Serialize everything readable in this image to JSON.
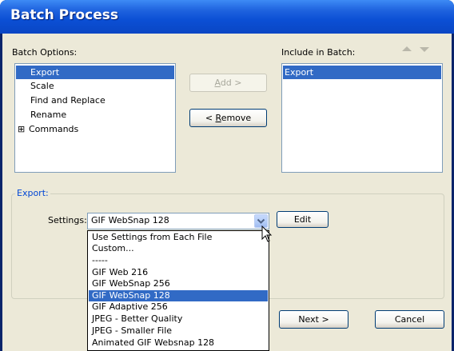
{
  "window": {
    "title": "Batch Process"
  },
  "batch_options": {
    "label": "Batch Options:",
    "items": [
      {
        "label": "Export",
        "selected": true,
        "expandable": false
      },
      {
        "label": "Scale",
        "selected": false,
        "expandable": false
      },
      {
        "label": "Find and Replace",
        "selected": false,
        "expandable": false
      },
      {
        "label": "Rename",
        "selected": false,
        "expandable": false
      },
      {
        "label": "Commands",
        "selected": false,
        "expandable": true,
        "expander": "⊞"
      }
    ]
  },
  "buttons": {
    "add": {
      "prefix": "",
      "underline": "A",
      "rest": "dd >"
    },
    "remove": {
      "prefix": "< ",
      "underline": "R",
      "rest": "emove"
    },
    "edit_label": "Edit",
    "next_label": "Next >",
    "cancel_label": "Cancel"
  },
  "include_in_batch": {
    "label": "Include in Batch:",
    "items": [
      {
        "label": "Export",
        "selected": true
      }
    ]
  },
  "export_group": {
    "title": "Export:",
    "settings_label": "Settings:",
    "settings_value": "GIF WebSnap 128",
    "options": [
      "Use Settings from Each File",
      "Custom...",
      "-----",
      "GIF Web 216",
      "GIF WebSnap 256",
      "GIF WebSnap 128",
      "GIF Adaptive 256",
      "JPEG - Better Quality",
      "JPEG - Smaller File",
      "Animated GIF Websnap 128"
    ],
    "highlighted_option": "GIF WebSnap 128"
  },
  "icons": {
    "move_up": "triangle-up",
    "move_down": "triangle-down",
    "combo_arrow": "chevron-down",
    "cursor": "mouse-pointer"
  },
  "colors": {
    "title_bar": "#0b4fd4",
    "selection": "#316ac5",
    "group_title": "#0046d5",
    "dialog_bg": "#ece9d8"
  }
}
